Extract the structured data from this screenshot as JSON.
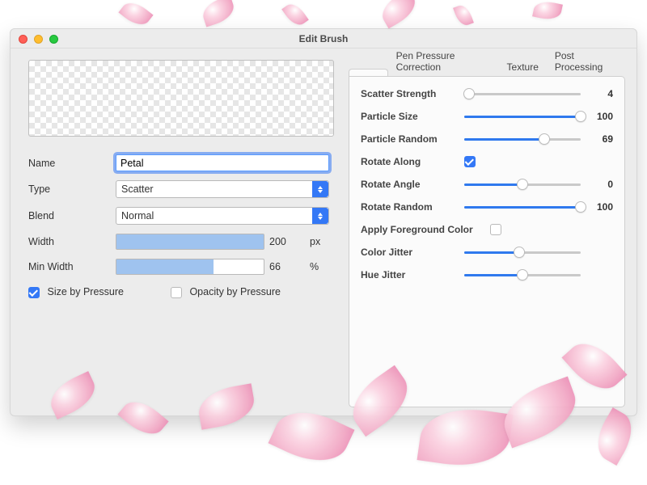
{
  "window": {
    "title": "Edit Brush"
  },
  "left": {
    "labels": {
      "name": "Name",
      "type": "Type",
      "blend": "Blend",
      "width": "Width",
      "min_width": "Min Width"
    },
    "name_value": "Petal",
    "type_value": "Scatter",
    "blend_value": "Normal",
    "width": {
      "value": "200",
      "unit": "px",
      "fill_pct": 100
    },
    "min_width": {
      "value": "66",
      "unit": "%",
      "fill_pct": 66
    },
    "size_by_pressure": {
      "label": "Size by Pressure",
      "checked": true
    },
    "opacity_by_pressure": {
      "label": "Opacity by Pressure",
      "checked": false
    }
  },
  "right": {
    "tabs": {
      "t1": "",
      "t2": "Pen Pressure Correction",
      "t3": "Texture",
      "t4": "Post Processing"
    },
    "sliders": {
      "scatter_strength": {
        "label": "Scatter Strength",
        "value": "4",
        "pct": 4
      },
      "particle_size": {
        "label": "Particle Size",
        "value": "100",
        "pct": 100
      },
      "particle_random": {
        "label": "Particle Random",
        "value": "69",
        "pct": 69
      },
      "rotate_along": {
        "label": "Rotate Along",
        "checked": true
      },
      "rotate_angle": {
        "label": "Rotate Angle",
        "value": "0",
        "pct": 50
      },
      "rotate_random": {
        "label": "Rotate Random",
        "value": "100",
        "pct": 100
      },
      "apply_fg": {
        "label": "Apply Foreground Color",
        "checked": false
      },
      "color_jitter": {
        "label": "Color Jitter",
        "value": "",
        "pct": 47
      },
      "hue_jitter": {
        "label": "Hue Jitter",
        "value": "",
        "pct": 50
      }
    }
  }
}
